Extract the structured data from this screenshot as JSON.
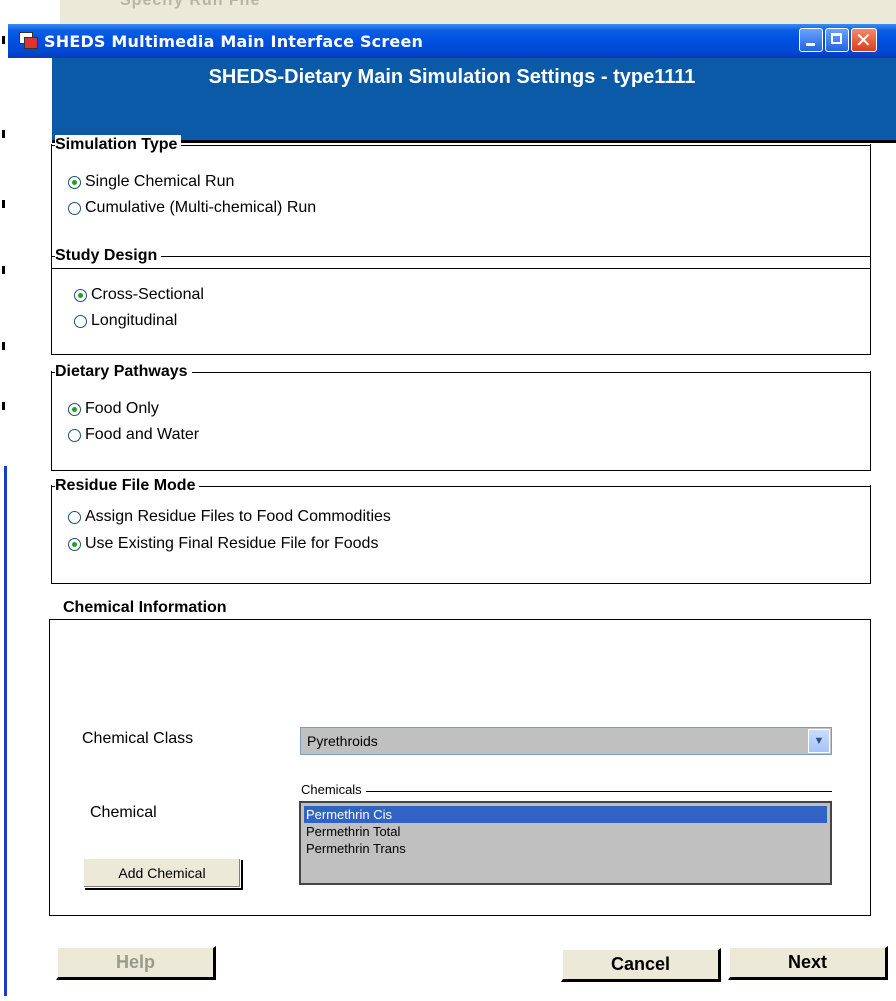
{
  "window": {
    "title": "SHEDS Multimedia Main Interface Screen",
    "banner": "SHEDS-Dietary Main Simulation Settings - type1111"
  },
  "background": {
    "ghost_text": "Specify Run File"
  },
  "simulation_type": {
    "legend": "Simulation Type",
    "options": [
      {
        "label": "Single Chemical Run",
        "selected": true
      },
      {
        "label": "Cumulative (Multi-chemical) Run",
        "selected": false
      }
    ]
  },
  "study_design": {
    "legend": "Study Design",
    "options": [
      {
        "label": "Cross-Sectional",
        "selected": true
      },
      {
        "label": "Longitudinal",
        "selected": false
      }
    ]
  },
  "dietary_pathways": {
    "legend": "Dietary Pathways",
    "options": [
      {
        "label": "Food Only",
        "selected": true
      },
      {
        "label": "Food and Water",
        "selected": false
      }
    ]
  },
  "residue_file_mode": {
    "legend": "Residue File Mode",
    "options": [
      {
        "label": "Assign Residue Files to Food Commodities",
        "selected": false
      },
      {
        "label": "Use Existing Final Residue File for Foods",
        "selected": true
      }
    ]
  },
  "chemical_information": {
    "legend": "Chemical Information",
    "class_label": "Chemical Class",
    "class_value": "Pyrethroids",
    "chemical_label": "Chemical",
    "chemicals_legend": "Chemicals",
    "chemicals": [
      "Permethrin Cis",
      "Permethrin Total",
      "Permethrin Trans"
    ],
    "selected_chemical": "Permethrin Cis",
    "add_button": "Add Chemical"
  },
  "footer": {
    "help": "Help",
    "cancel": "Cancel",
    "next": "Next"
  },
  "colors": {
    "titlebar": "#0050e0",
    "banner": "#0b5aa8",
    "radio_dot": "#21a121",
    "list_selection": "#3163c5"
  }
}
